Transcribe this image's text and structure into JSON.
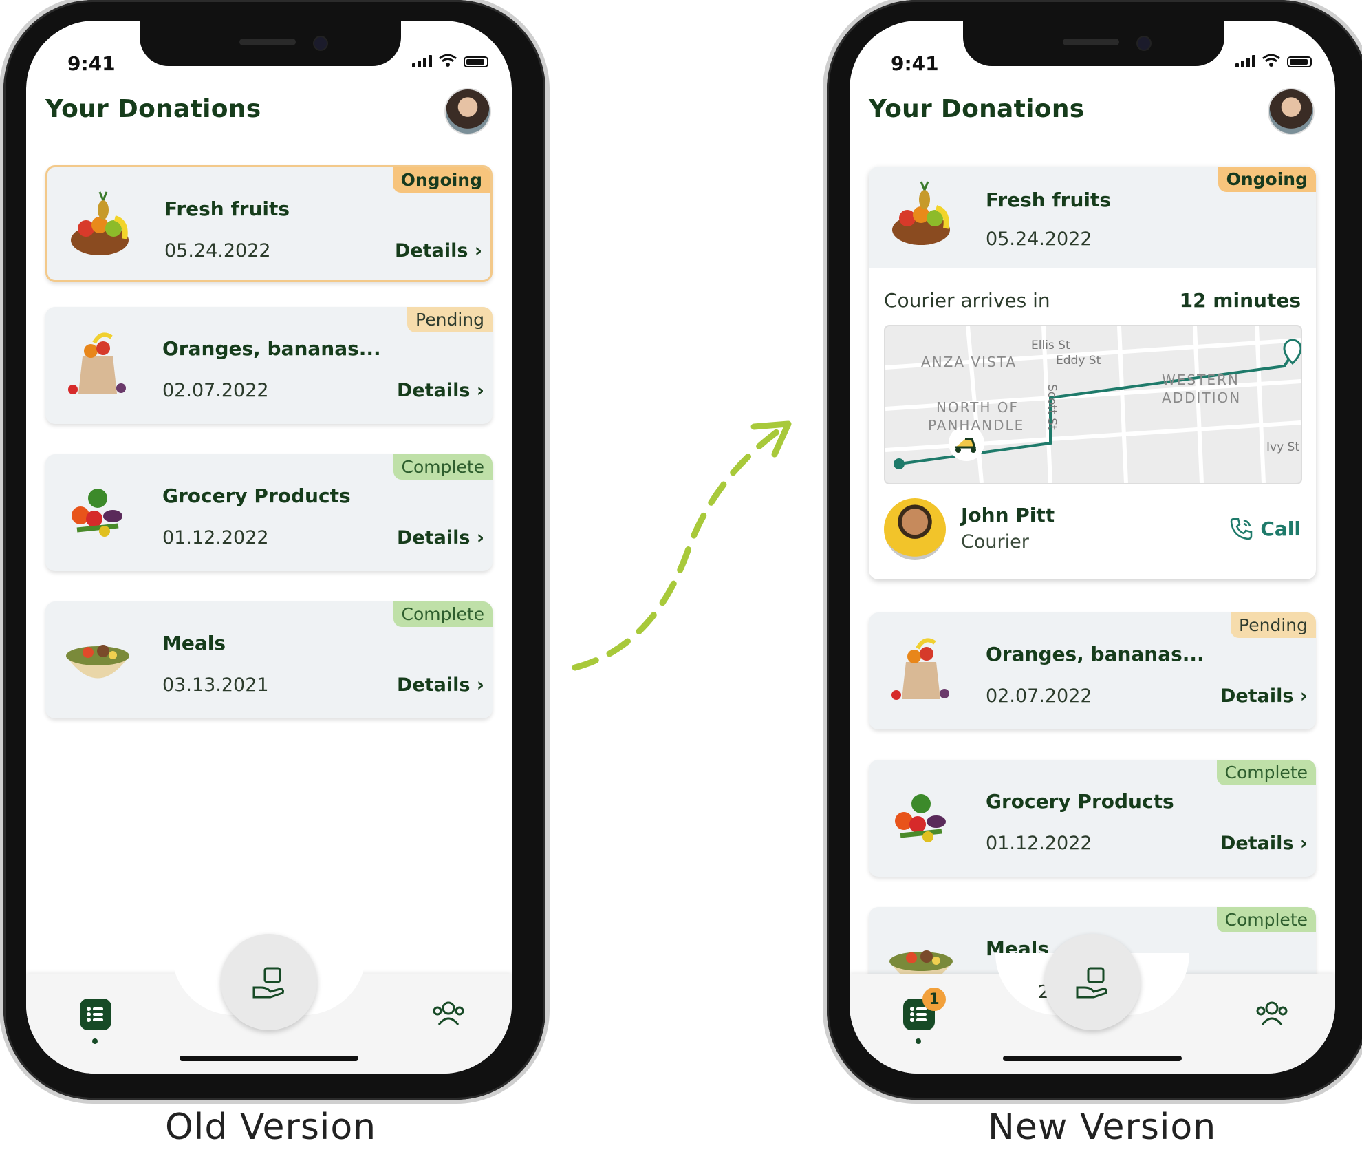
{
  "status_bar": {
    "time": "9:41"
  },
  "header": {
    "title": "Your Donations"
  },
  "old": {
    "label": "Old Version",
    "cards": [
      {
        "title": "Fresh fruits",
        "date": "05.24.2022",
        "status": "Ongoing",
        "details": "Details"
      },
      {
        "title": "Oranges, bananas...",
        "date": "02.07.2022",
        "status": "Pending",
        "details": "Details"
      },
      {
        "title": "Grocery Products",
        "date": "01.12.2022",
        "status": "Complete",
        "details": "Details"
      },
      {
        "title": "Meals",
        "date": "03.13.2021",
        "status": "Complete",
        "details": "Details"
      }
    ]
  },
  "new": {
    "label": "New Version",
    "ongoing": {
      "title": "Fresh fruits",
      "date": "05.24.2022",
      "status": "Ongoing"
    },
    "courier": {
      "arrives_label": "Courier arrives in",
      "eta": "12 minutes",
      "name": "John Pitt",
      "role": "Courier",
      "call_label": "Call"
    },
    "map": {
      "labels": [
        "ANZA VISTA",
        "Ellis St",
        "Eddy St",
        "WESTERN",
        "ADDITION",
        "NORTH OF",
        "PANHANDLE",
        "Scott St",
        "Ivy St"
      ]
    },
    "cards": [
      {
        "title": "Oranges, bananas...",
        "date": "02.07.2022",
        "status": "Pending",
        "details": "Details"
      },
      {
        "title": "Grocery Products",
        "date": "01.12.2022",
        "status": "Complete",
        "details": "Details"
      },
      {
        "title": "Meals",
        "status": "Complete"
      }
    ],
    "tab_badge": "1",
    "partial_text": "2"
  },
  "colors": {
    "primary": "#173a1f",
    "ongoing": "#f7c47c",
    "pending": "#f6dcac",
    "complete": "#bfe0a8",
    "route": "#1e7a6a",
    "arrow": "#a8c93a"
  }
}
